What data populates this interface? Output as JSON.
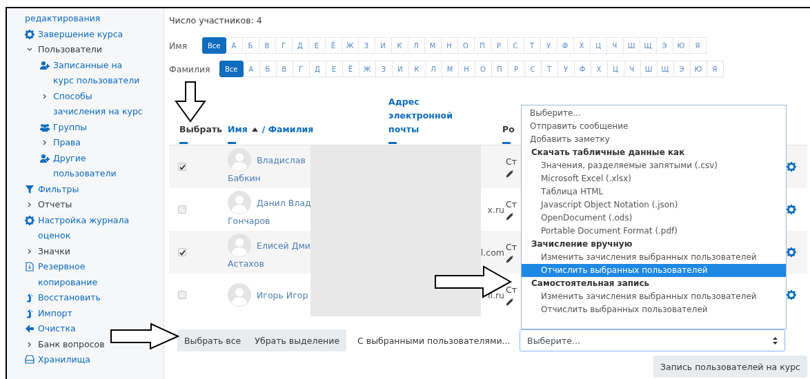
{
  "sidebar": {
    "items": [
      {
        "label": "редактирования",
        "kind": "link"
      },
      {
        "label": "Завершение курса",
        "kind": "link"
      },
      {
        "label": "Пользователи",
        "kind": "section",
        "expanded": true,
        "children": [
          {
            "label": "Записанные на курс пользователи",
            "kind": "link"
          },
          {
            "label": "Способы зачисления на курс",
            "kind": "link"
          },
          {
            "label": "Группы",
            "kind": "link"
          },
          {
            "label": "Права",
            "kind": "link"
          },
          {
            "label": "Другие пользователи",
            "kind": "link"
          }
        ]
      },
      {
        "label": "Фильтры",
        "kind": "link"
      },
      {
        "label": "Отчеты",
        "kind": "section"
      },
      {
        "label": "Настройка журнала оценок",
        "kind": "link"
      },
      {
        "label": "Значки",
        "kind": "section"
      },
      {
        "label": "Резервное копирование",
        "kind": "link"
      },
      {
        "label": "Восстановить",
        "kind": "link"
      },
      {
        "label": "Импорт",
        "kind": "link"
      },
      {
        "label": "Очистка",
        "kind": "link"
      },
      {
        "label": "Банк вопросов",
        "kind": "section"
      },
      {
        "label": "Хранилища",
        "kind": "link"
      }
    ]
  },
  "participants": "Число участников: 4",
  "initials_filters": [
    {
      "label": "Имя",
      "letters": [
        {
          "label": "Все",
          "selected": true
        },
        {
          "label": "А",
          "selected": false
        },
        {
          "label": "Б",
          "selected": false
        },
        {
          "label": "В",
          "selected": false
        },
        {
          "label": "Г",
          "selected": false
        },
        {
          "label": "Д",
          "selected": false
        },
        {
          "label": "Е",
          "selected": false
        },
        {
          "label": "Ё",
          "selected": false
        },
        {
          "label": "Ж",
          "selected": false
        },
        {
          "label": "З",
          "selected": false
        },
        {
          "label": "И",
          "selected": false
        },
        {
          "label": "К",
          "selected": false
        },
        {
          "label": "Л",
          "selected": false
        },
        {
          "label": "М",
          "selected": false
        },
        {
          "label": "Н",
          "selected": false
        },
        {
          "label": "О",
          "selected": false
        },
        {
          "label": "П",
          "selected": false
        },
        {
          "label": "Р",
          "selected": false
        },
        {
          "label": "С",
          "selected": false
        },
        {
          "label": "Т",
          "selected": false
        },
        {
          "label": "У",
          "selected": false
        },
        {
          "label": "Ф",
          "selected": false
        },
        {
          "label": "Х",
          "selected": false
        },
        {
          "label": "Ц",
          "selected": false
        },
        {
          "label": "Ч",
          "selected": false
        },
        {
          "label": "Ш",
          "selected": false
        },
        {
          "label": "Щ",
          "selected": false
        },
        {
          "label": "Э",
          "selected": false
        },
        {
          "label": "Ю",
          "selected": false
        },
        {
          "label": "Я",
          "selected": false
        }
      ]
    },
    {
      "label": "Фамилия",
      "letters": [
        {
          "label": "Все",
          "selected": true
        },
        {
          "label": "А",
          "selected": false
        },
        {
          "label": "Б",
          "selected": false
        },
        {
          "label": "В",
          "selected": false
        },
        {
          "label": "Г",
          "selected": false
        },
        {
          "label": "Д",
          "selected": false
        },
        {
          "label": "Е",
          "selected": false
        },
        {
          "label": "Ё",
          "selected": false
        },
        {
          "label": "Ж",
          "selected": false
        },
        {
          "label": "З",
          "selected": false
        },
        {
          "label": "И",
          "selected": false
        },
        {
          "label": "К",
          "selected": false
        },
        {
          "label": "Л",
          "selected": false
        },
        {
          "label": "М",
          "selected": false
        },
        {
          "label": "Н",
          "selected": false
        },
        {
          "label": "О",
          "selected": false
        },
        {
          "label": "П",
          "selected": false
        },
        {
          "label": "Р",
          "selected": false
        },
        {
          "label": "С",
          "selected": false
        },
        {
          "label": "Т",
          "selected": false
        },
        {
          "label": "У",
          "selected": false
        },
        {
          "label": "Ф",
          "selected": false
        },
        {
          "label": "Х",
          "selected": false
        },
        {
          "label": "Ц",
          "selected": false
        },
        {
          "label": "Ч",
          "selected": false
        },
        {
          "label": "Ш",
          "selected": false
        },
        {
          "label": "Щ",
          "selected": false
        },
        {
          "label": "Э",
          "selected": false
        },
        {
          "label": "Ю",
          "selected": false
        },
        {
          "label": "Я",
          "selected": false
        }
      ]
    }
  ],
  "table": {
    "header": {
      "select": "Выбрать",
      "first_name": "Имя",
      "last_name": "/ Фамилия",
      "email": "Адрес электронной почты",
      "role": "Ро"
    },
    "rows": [
      {
        "checked": true,
        "first_name": "Владислав",
        "last_name": "Бабкин",
        "role": "Ст"
      },
      {
        "checked": false,
        "first_name": "Данил Влад",
        "last_name": "Гончаров",
        "email": "x.ru",
        "role": "Ст"
      },
      {
        "checked": true,
        "first_name": "Елисей Дми",
        "last_name": "Астахов",
        "email": "l.com",
        "role": "Ст"
      },
      {
        "checked": false,
        "first_name": "Игорь Игор",
        "email": "il.ru",
        "role": "Ст"
      }
    ]
  },
  "bulk": {
    "buttons": [
      "Выбрать все",
      "Убрать выделение"
    ],
    "label": "С выбранными пользователями...",
    "select_value": "Выберите...",
    "options": [
      {
        "label": "Выберите...",
        "kind": "option",
        "selected": false
      },
      {
        "label": "Отправить сообщение",
        "kind": "option",
        "selected": false
      },
      {
        "label": "Добавить заметку",
        "kind": "option",
        "selected": false
      },
      {
        "label": "Скачать табличные данные как",
        "kind": "group",
        "selected": false
      },
      {
        "label": "Значения, разделяемые запятыми (.csv)",
        "kind": "suboption",
        "selected": false
      },
      {
        "label": "Microsoft Excel (.xlsx)",
        "kind": "suboption",
        "selected": false
      },
      {
        "label": "Таблица HTML",
        "kind": "suboption",
        "selected": false
      },
      {
        "label": "Javascript Object Notation (.json)",
        "kind": "suboption",
        "selected": false
      },
      {
        "label": "OpenDocument (.ods)",
        "kind": "suboption",
        "selected": false
      },
      {
        "label": "Portable Document Format (.pdf)",
        "kind": "suboption",
        "selected": false
      },
      {
        "label": "Зачисление вручную",
        "kind": "group",
        "selected": false
      },
      {
        "label": "Изменить зачисления выбранных пользователей",
        "kind": "suboption",
        "selected": false
      },
      {
        "label": "Отчислить выбранных пользователей",
        "kind": "suboption",
        "selected": true
      },
      {
        "label": "Самостоятельная запись",
        "kind": "group",
        "selected": false
      },
      {
        "label": "Изменить зачисления выбранных пользователей",
        "kind": "suboption",
        "selected": false
      },
      {
        "label": "Отчислить выбранных пользователей",
        "kind": "suboption",
        "selected": false
      }
    ]
  },
  "enrol_button": "Запись пользователей на курс"
}
